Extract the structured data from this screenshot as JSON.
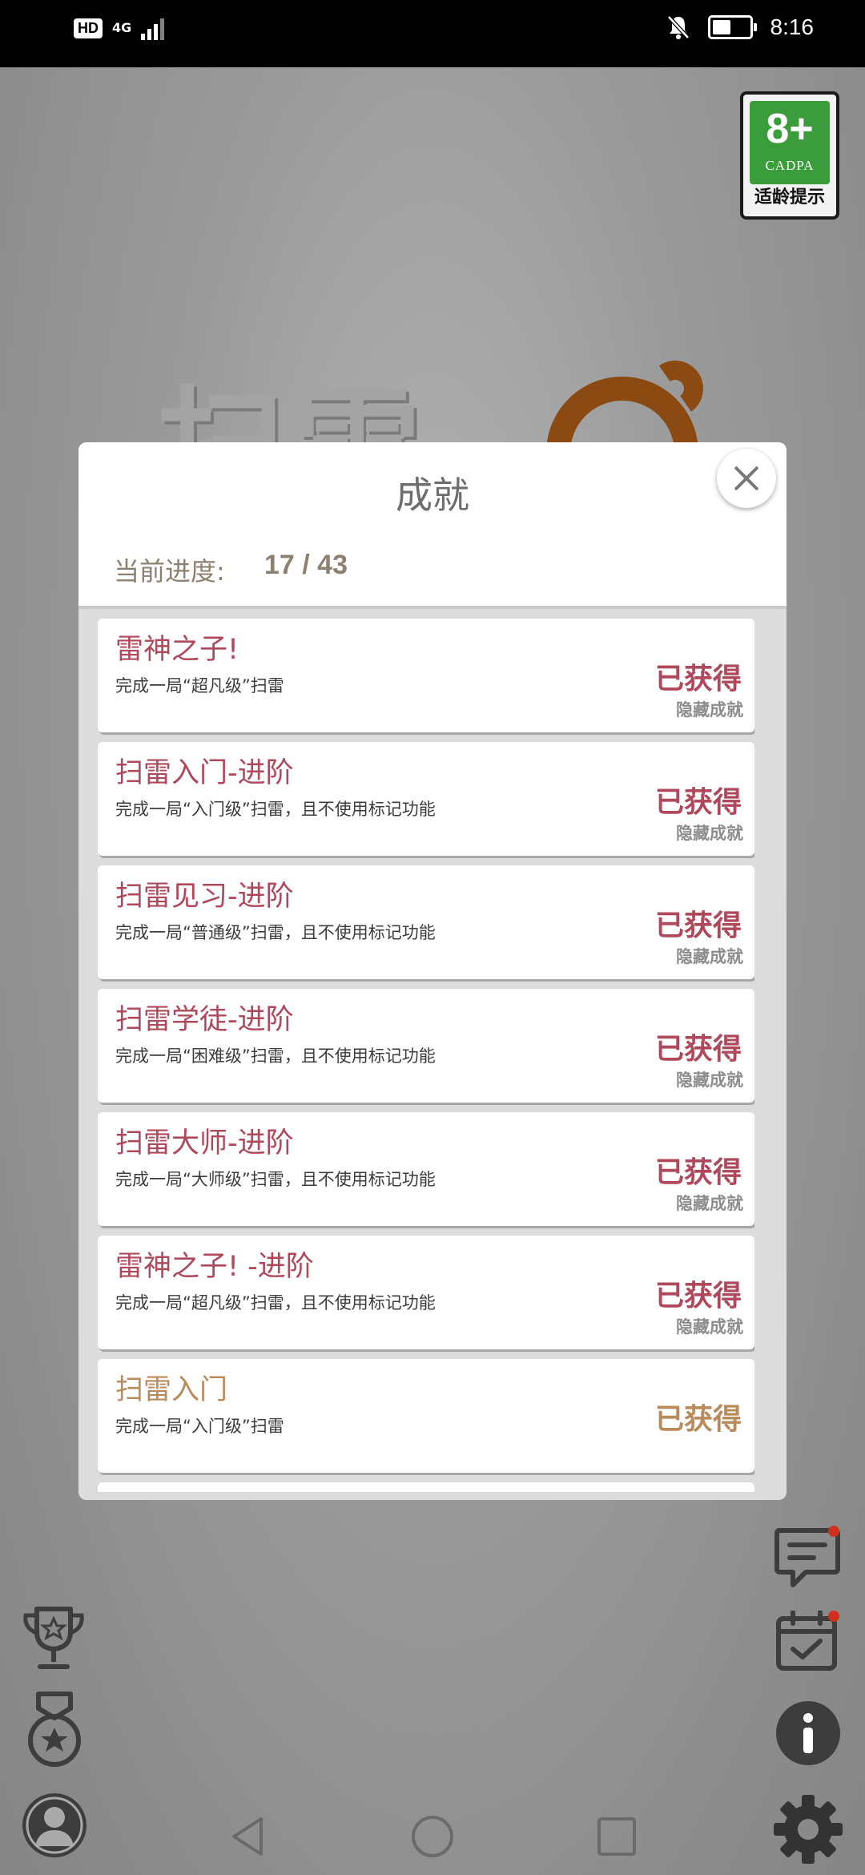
{
  "status_bar": {
    "hd": "HD",
    "network": "4G",
    "time": "8:16",
    "battery_level": 0.6
  },
  "rating_badge": {
    "age": "8+",
    "org": "CADPA",
    "label": "适龄提示"
  },
  "background": {
    "logo_text": "扫雷"
  },
  "achievements_dialog": {
    "title": "成就",
    "progress_label": "当前进度:",
    "progress_value": "17 / 43",
    "items": [
      {
        "title": "雷神之子!",
        "desc": "完成一局“超凡级”扫雷",
        "status": "已获得",
        "hidden_label": "隐藏成就",
        "style": "red"
      },
      {
        "title": "扫雷入门-进阶",
        "desc": "完成一局“入门级”扫雷，且不使用标记功能",
        "status": "已获得",
        "hidden_label": "隐藏成就",
        "style": "red"
      },
      {
        "title": "扫雷见习-进阶",
        "desc": "完成一局“普通级”扫雷，且不使用标记功能",
        "status": "已获得",
        "hidden_label": "隐藏成就",
        "style": "red"
      },
      {
        "title": "扫雷学徒-进阶",
        "desc": "完成一局“困难级”扫雷，且不使用标记功能",
        "status": "已获得",
        "hidden_label": "隐藏成就",
        "style": "red"
      },
      {
        "title": "扫雷大师-进阶",
        "desc": "完成一局“大师级”扫雷，且不使用标记功能",
        "status": "已获得",
        "hidden_label": "隐藏成就",
        "style": "red"
      },
      {
        "title": "雷神之子! -进阶",
        "desc": "完成一局“超凡级”扫雷，且不使用标记功能",
        "status": "已获得",
        "hidden_label": "隐藏成就",
        "style": "red"
      },
      {
        "title": "扫雷入门",
        "desc": "完成一局“入门级”扫雷",
        "status": "已获得",
        "hidden_label": "",
        "style": "gold"
      }
    ]
  },
  "colors": {
    "hidden_achievement": "#b0485c",
    "normal_achievement": "#b98a5a",
    "notification_dot": "#d0311c"
  }
}
